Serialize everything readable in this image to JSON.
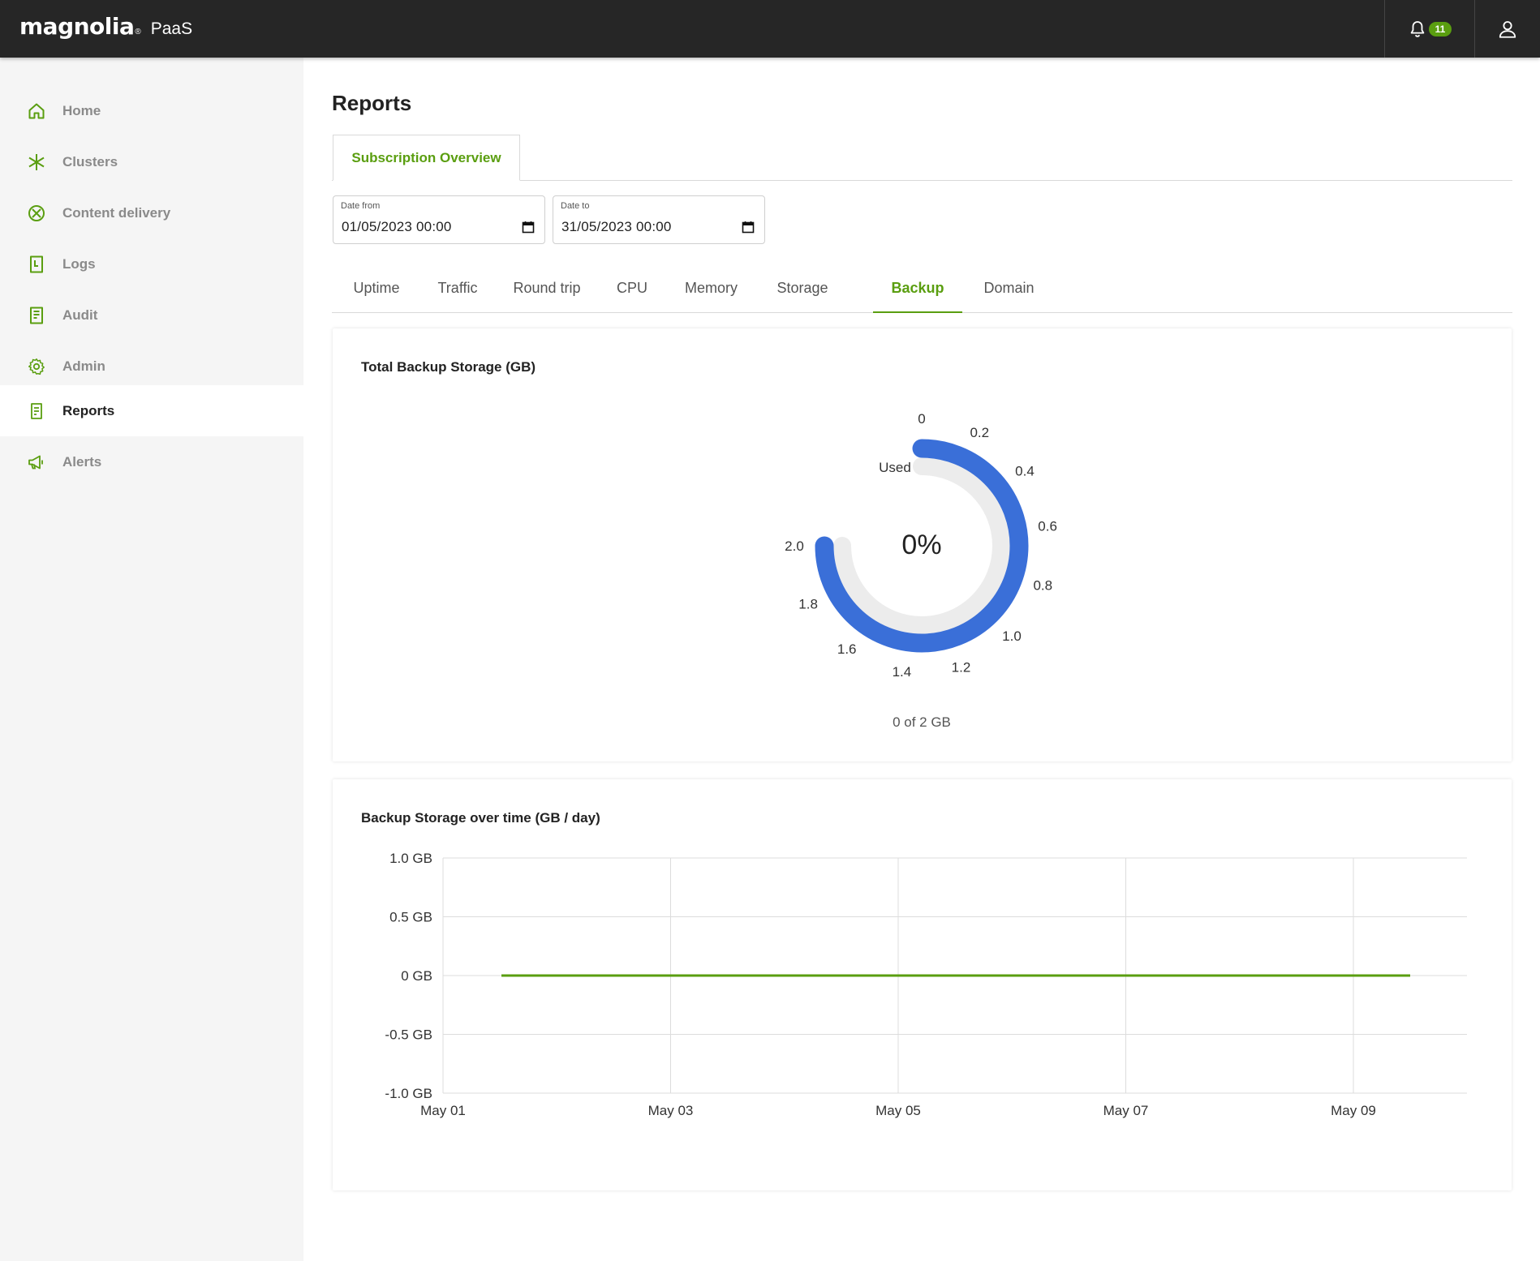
{
  "header": {
    "brand": "magnolia",
    "brand_mark": "®",
    "product": "PaaS",
    "notification_count": "11",
    "bell_icon": "bell-icon",
    "user_icon": "user-icon"
  },
  "sidebar": {
    "items": [
      {
        "label": "Home",
        "icon": "home-icon"
      },
      {
        "label": "Clusters",
        "icon": "clusters-icon"
      },
      {
        "label": "Content delivery",
        "icon": "content-delivery-icon"
      },
      {
        "label": "Logs",
        "icon": "logs-icon"
      },
      {
        "label": "Audit",
        "icon": "audit-icon"
      },
      {
        "label": "Admin",
        "icon": "gear-icon"
      },
      {
        "label": "Reports",
        "icon": "reports-icon",
        "active": true
      },
      {
        "label": "Alerts",
        "icon": "megaphone-icon"
      }
    ]
  },
  "main": {
    "title": "Reports",
    "tab": "Subscription Overview",
    "date_from": {
      "label": "Date from",
      "value": "01/05/2023 00:00"
    },
    "date_to": {
      "label": "Date to",
      "value": "31/05/2023 00:00"
    },
    "subtabs": [
      "Uptime",
      "Traffic",
      "Round trip",
      "CPU",
      "Memory",
      "Storage",
      "Backup",
      "Domain"
    ],
    "active_subtab": "Backup"
  },
  "colors": {
    "brand_green": "#5a9e10",
    "gauge_blue": "#3a6fd8",
    "gauge_track": "#ececec",
    "topbar": "#262626"
  },
  "gauge": {
    "title": "Total Backup Storage (GB)",
    "center_text": "0%",
    "label": "Used",
    "footer": "0 of 2 GB",
    "min": 0,
    "max": 2,
    "value": 0,
    "ticks": [
      "0",
      "0.2",
      "0.4",
      "0.6",
      "0.8",
      "1.0",
      "1.2",
      "1.4",
      "1.6",
      "1.8",
      "2.0"
    ]
  },
  "chart_data": {
    "type": "line",
    "title": "Backup Storage over time (GB / day)",
    "x": [
      "May 01",
      "May 03",
      "May 05",
      "May 07",
      "May 09"
    ],
    "y_ticks": [
      "1.0 GB",
      "0.5 GB",
      "0 GB",
      "-0.5 GB",
      "-1.0 GB"
    ],
    "ylim": [
      -1.0,
      1.0
    ],
    "series": [
      {
        "values": [
          0,
          0,
          0,
          0,
          0,
          0,
          0,
          0,
          0
        ]
      }
    ],
    "grid": true
  }
}
